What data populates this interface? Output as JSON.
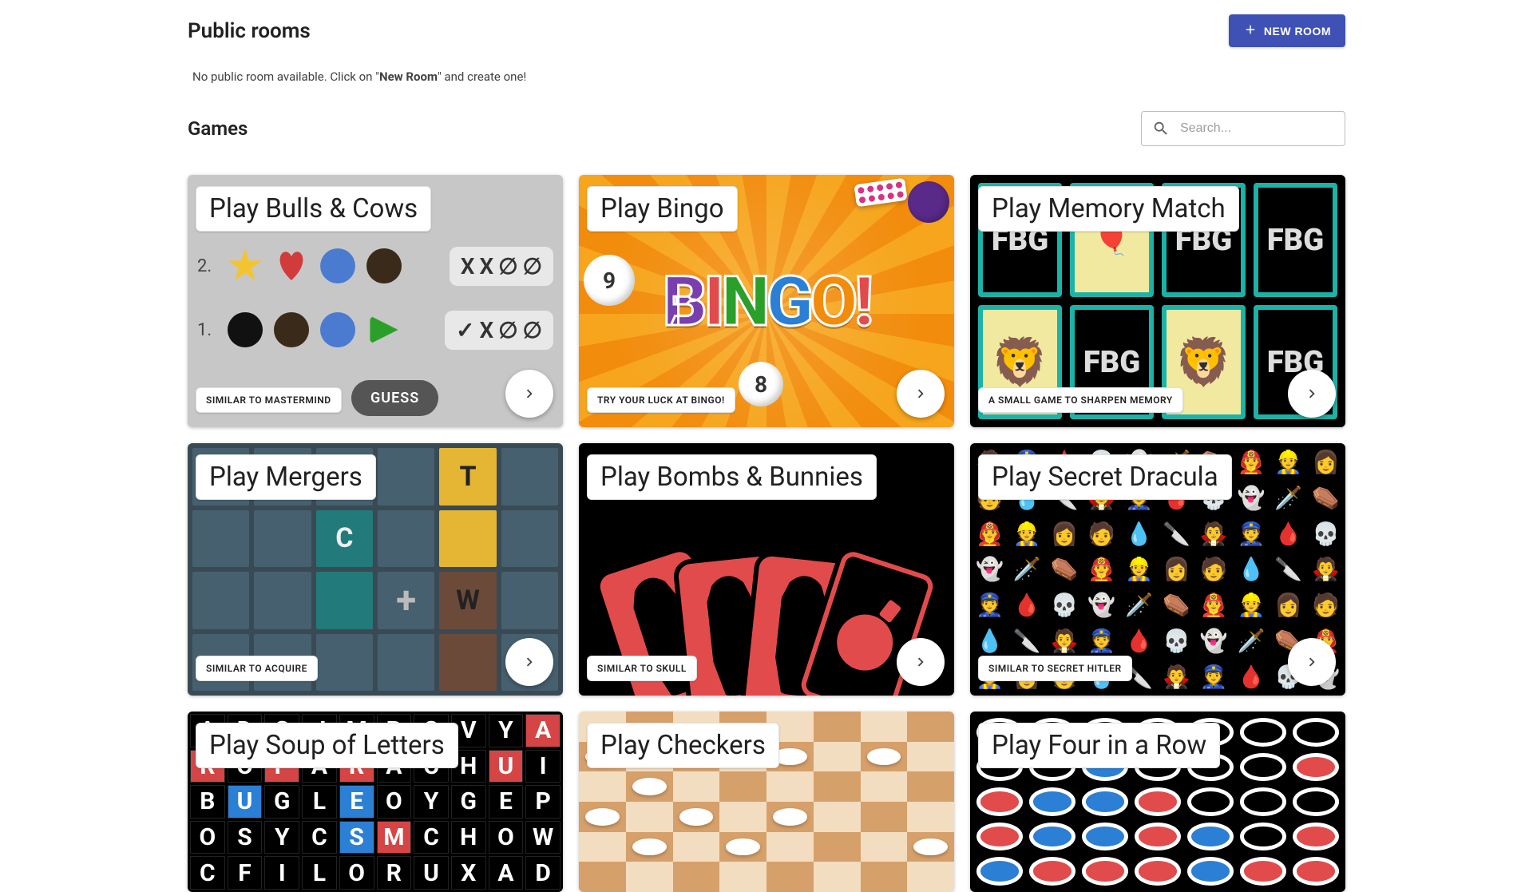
{
  "header": {
    "public_rooms_title": "Public rooms",
    "new_room_label": "NEW ROOM"
  },
  "empty_message": {
    "prefix": "No public room available. Click on \"",
    "bold": "New Room",
    "suffix": "\" and create one!"
  },
  "games_header": {
    "title": "Games"
  },
  "search": {
    "placeholder": "Search..."
  },
  "games": [
    {
      "title": "Play Bulls & Cows",
      "tag": "SIMILAR TO MASTERMIND",
      "bg": "bulls"
    },
    {
      "title": "Play Bingo",
      "tag": "TRY YOUR LUCK AT BINGO!",
      "bg": "bingo"
    },
    {
      "title": "Play Memory Match",
      "tag": "A SMALL GAME TO SHARPEN MEMORY",
      "bg": "memory"
    },
    {
      "title": "Play Mergers",
      "tag": "SIMILAR TO ACQUIRE",
      "bg": "mergers"
    },
    {
      "title": "Play Bombs & Bunnies",
      "tag": "SIMILAR TO SKULL",
      "bg": "bombs"
    },
    {
      "title": "Play Secret Dracula",
      "tag": "SIMILAR TO SECRET HITLER",
      "bg": "dracula"
    },
    {
      "title": "Play Soup of Letters",
      "tag": "",
      "bg": "soup"
    },
    {
      "title": "Play Checkers",
      "tag": "",
      "bg": "checkers"
    },
    {
      "title": "Play Four in a Row",
      "tag": "",
      "bg": "four"
    }
  ],
  "bulls": {
    "row2_num": "2.",
    "row1_num": "1.",
    "marks2": [
      "X",
      "X",
      "∅",
      "∅"
    ],
    "marks1": [
      "✓",
      "X",
      "∅",
      "∅"
    ],
    "guess_label": "GUESS"
  },
  "colors": {
    "primary": "#3f51b5"
  }
}
